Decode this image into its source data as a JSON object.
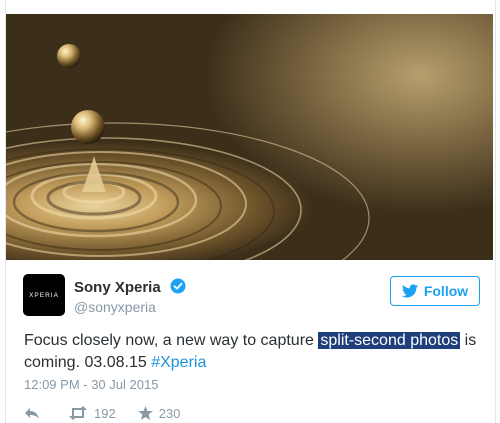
{
  "tweet": {
    "author_name": "Sony Xperia",
    "handle": "@sonyxperia",
    "avatar_text": "XPERIA",
    "follow_label": "Follow",
    "text_before": "Focus closely now, a new way to capture ",
    "text_highlight": "split-second photos",
    "text_after": " is coming. 03.08.15 ",
    "hashtag": "#Xperia",
    "timestamp": "12:09 PM - 30 Jul 2015",
    "retweets": "192",
    "favorites": "230"
  },
  "colors": {
    "accent": "#1da1f2",
    "highlight_bg": "#1f3f7a",
    "muted": "#8899a6"
  },
  "icons": [
    "verified-badge-icon",
    "twitter-bird-icon",
    "reply-icon",
    "retweet-icon",
    "favorite-star-icon"
  ]
}
